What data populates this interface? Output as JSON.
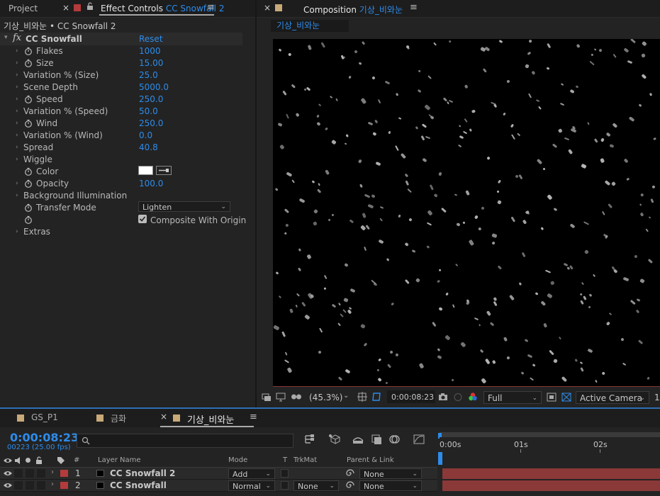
{
  "left_panel": {
    "tabs": {
      "project_label": "Project",
      "effect_controls_label": "Effect Controls",
      "effect_controls_layer": "CC Snowfall 2"
    },
    "breadcrumb": "기상_비와눈 • CC Snowfall 2",
    "effect": {
      "fx_label": "fx",
      "name": "CC Snowfall",
      "reset_label": "Reset"
    },
    "properties": [
      {
        "label": "Flakes",
        "value": "1000",
        "stopwatch": true
      },
      {
        "label": "Size",
        "value": "15.00",
        "stopwatch": true
      },
      {
        "label": "Variation % (Size)",
        "value": "25.0",
        "stopwatch": false
      },
      {
        "label": "Scene Depth",
        "value": "5000.0",
        "stopwatch": false
      },
      {
        "label": "Speed",
        "value": "250.0",
        "stopwatch": true
      },
      {
        "label": "Variation % (Speed)",
        "value": "50.0",
        "stopwatch": false
      },
      {
        "label": "Wind",
        "value": "250.0",
        "stopwatch": true
      },
      {
        "label": "Variation % (Wind)",
        "value": "0.0",
        "stopwatch": false
      },
      {
        "label": "Spread",
        "value": "40.8",
        "stopwatch": false
      },
      {
        "label": "Wiggle",
        "value": "",
        "stopwatch": false
      },
      {
        "label": "Color",
        "value": "",
        "stopwatch": true
      },
      {
        "label": "Opacity",
        "value": "100.0",
        "stopwatch": true
      },
      {
        "label": "Background Illumination",
        "value": "",
        "stopwatch": false
      },
      {
        "label": "Transfer Mode",
        "value": "",
        "stopwatch": true
      },
      {
        "label": "",
        "value": "",
        "stopwatch": true
      },
      {
        "label": "Extras",
        "value": "",
        "stopwatch": false
      }
    ],
    "color_swatch": "#ffffff",
    "transfer_mode_value": "Lighten",
    "composite_label": "Composite With Origin",
    "composite_checked": true
  },
  "composition": {
    "tab_prefix": "Composition",
    "tab_name": "기상_비와눈",
    "comp_chip": "기상_비와눈",
    "viewer": {
      "zoom": "(45.3%)",
      "timecode": "0:00:08:23",
      "resolution": "Full",
      "camera": "Active Camera",
      "view_count": "1"
    }
  },
  "timeline": {
    "tabs": [
      {
        "label": "GS_P1",
        "color": "#c8a978",
        "active": false
      },
      {
        "label": "금화",
        "color": "#c8a978",
        "active": false
      },
      {
        "label": "기상_비와눈",
        "color": "#c8a978",
        "active": true
      }
    ],
    "timecode": "0:00:08:23",
    "frames_fps": "00223 (25.00 fps)",
    "search_placeholder": "",
    "headers": {
      "hash": "#",
      "layer_name": "Layer Name",
      "mode": "Mode",
      "t": "T",
      "trkmat": "TrkMat",
      "parent_link": "Parent & Link"
    },
    "ruler": [
      "0:00s",
      "01s",
      "02s"
    ],
    "layers": [
      {
        "num": "1",
        "name": "CC Snowfall 2",
        "mode": "Add",
        "trkmat": "",
        "parent": "None",
        "label_color": "#b33b3b"
      },
      {
        "num": "2",
        "name": "CC Snowfall",
        "mode": "Normal",
        "trkmat": "None",
        "parent": "None",
        "label_color": "#b33b3b"
      }
    ],
    "bar_color": "#8a3838"
  },
  "colors": {
    "accent": "#2d8ceb",
    "label_red": "#b33b3b"
  }
}
